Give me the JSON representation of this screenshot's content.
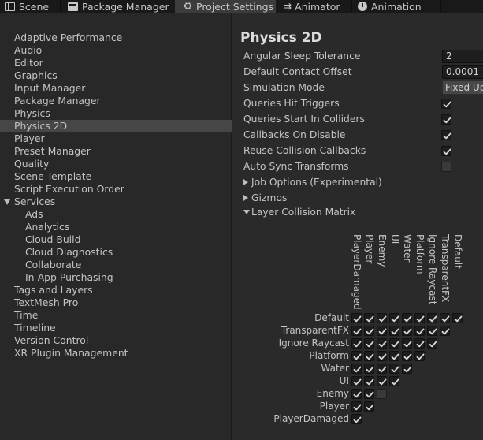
{
  "tabs": [
    {
      "label": "Scene",
      "icon": "scene-icon",
      "active": false
    },
    {
      "label": "Package Manager",
      "icon": "package-icon",
      "active": false
    },
    {
      "label": "Project Settings",
      "icon": "gear-icon",
      "active": true
    },
    {
      "label": "Animator",
      "icon": "animator-icon",
      "active": false
    },
    {
      "label": "Animation",
      "icon": "animation-icon",
      "active": false
    }
  ],
  "sidebar": {
    "items": [
      {
        "label": "Adaptive Performance",
        "indent": 0
      },
      {
        "label": "Audio",
        "indent": 0
      },
      {
        "label": "Editor",
        "indent": 0
      },
      {
        "label": "Graphics",
        "indent": 0
      },
      {
        "label": "Input Manager",
        "indent": 0
      },
      {
        "label": "Package Manager",
        "indent": 0
      },
      {
        "label": "Physics",
        "indent": 0
      },
      {
        "label": "Physics 2D",
        "indent": 0,
        "selected": true
      },
      {
        "label": "Player",
        "indent": 0
      },
      {
        "label": "Preset Manager",
        "indent": 0
      },
      {
        "label": "Quality",
        "indent": 0
      },
      {
        "label": "Scene Template",
        "indent": 0
      },
      {
        "label": "Script Execution Order",
        "indent": 0
      },
      {
        "label": "Services",
        "indent": 0,
        "expanded": true
      },
      {
        "label": "Ads",
        "indent": 1
      },
      {
        "label": "Analytics",
        "indent": 1
      },
      {
        "label": "Cloud Build",
        "indent": 1
      },
      {
        "label": "Cloud Diagnostics",
        "indent": 1
      },
      {
        "label": "Collaborate",
        "indent": 1
      },
      {
        "label": "In-App Purchasing",
        "indent": 1
      },
      {
        "label": "Tags and Layers",
        "indent": 0
      },
      {
        "label": "TextMesh Pro",
        "indent": 0
      },
      {
        "label": "Time",
        "indent": 0
      },
      {
        "label": "Timeline",
        "indent": 0
      },
      {
        "label": "Version Control",
        "indent": 0
      },
      {
        "label": "XR Plugin Management",
        "indent": 0
      }
    ]
  },
  "main": {
    "title": "Physics 2D",
    "properties": [
      {
        "label": "Angular Sleep Tolerance",
        "type": "field",
        "value": "2"
      },
      {
        "label": "Default Contact Offset",
        "type": "field",
        "value": "0.0001"
      },
      {
        "label": "Simulation Mode",
        "type": "dropdown",
        "value": "Fixed Up"
      },
      {
        "label": "Queries Hit Triggers",
        "type": "checkbox",
        "checked": true
      },
      {
        "label": "Queries Start In Colliders",
        "type": "checkbox",
        "checked": true
      },
      {
        "label": "Callbacks On Disable",
        "type": "checkbox",
        "checked": true
      },
      {
        "label": "Reuse Collision Callbacks",
        "type": "checkbox",
        "checked": true
      },
      {
        "label": "Auto Sync Transforms",
        "type": "checkbox",
        "checked": false
      }
    ],
    "foldouts": [
      {
        "label": "Job Options (Experimental)",
        "expanded": false
      },
      {
        "label": "Gizmos",
        "expanded": false
      },
      {
        "label": "Layer Collision Matrix",
        "expanded": true
      }
    ],
    "matrix": {
      "columns": [
        "PlayerDamaged",
        "Player",
        "Enemy",
        "UI",
        "Water",
        "Platform",
        "Ignore Raycast",
        "TransparentFX",
        "Default"
      ],
      "rows": [
        "Default",
        "TransparentFX",
        "Ignore Raycast",
        "Platform",
        "Water",
        "UI",
        "Enemy",
        "Player",
        "PlayerDamaged"
      ],
      "cells": [
        [
          true,
          true,
          true,
          true,
          true,
          true,
          true,
          true,
          true
        ],
        [
          true,
          true,
          true,
          true,
          true,
          true,
          true,
          true
        ],
        [
          true,
          true,
          true,
          true,
          true,
          true,
          true
        ],
        [
          true,
          true,
          true,
          true,
          true,
          true
        ],
        [
          true,
          true,
          true,
          true,
          true
        ],
        [
          true,
          true,
          true,
          true
        ],
        [
          true,
          true,
          false
        ],
        [
          true,
          true
        ],
        [
          true
        ]
      ]
    }
  },
  "colors": {
    "background": "#282828",
    "selected": "#464646",
    "text": "#c4c4c4"
  }
}
